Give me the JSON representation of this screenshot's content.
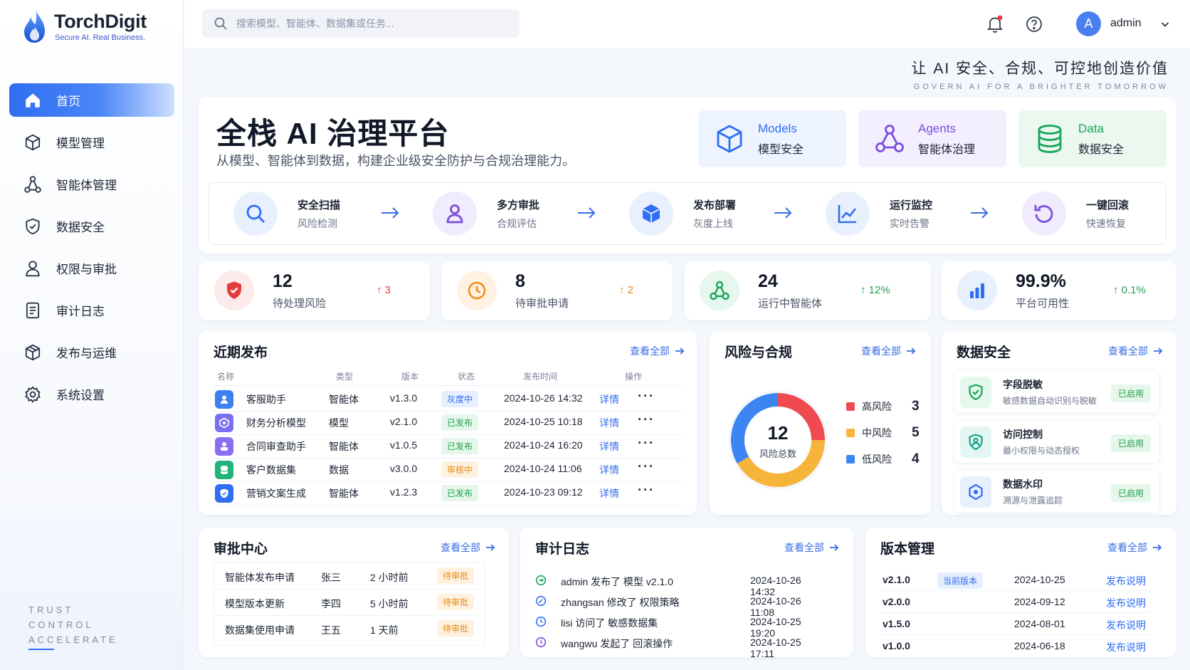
{
  "brand": {
    "name": "TorchDigit",
    "tagline": "Secure AI. Real Business."
  },
  "search": {
    "placeholder": "搜索模型、智能体、数据集或任务..."
  },
  "user": {
    "avatar_letter": "A",
    "name": "admin"
  },
  "sidebar": {
    "items": [
      {
        "label": "首页",
        "icon": "home-icon",
        "active": true
      },
      {
        "label": "模型管理",
        "icon": "cube-icon"
      },
      {
        "label": "智能体管理",
        "icon": "agent-network-icon"
      },
      {
        "label": "数据安全",
        "icon": "shield-icon"
      },
      {
        "label": "权限与审批",
        "icon": "user-icon"
      },
      {
        "label": "审计日志",
        "icon": "document-icon"
      },
      {
        "label": "发布与运维",
        "icon": "package-icon"
      },
      {
        "label": "系统设置",
        "icon": "gear-icon"
      }
    ],
    "footer_lines": [
      "TRUST",
      "CONTROL",
      "ACCELERATE"
    ]
  },
  "slogan": {
    "cn": "让 AI 安全、合规、可控地创造价值",
    "en": "GOVERN AI FOR A BRIGHTER TOMORROW"
  },
  "hero": {
    "title": "全栈 AI 治理平台",
    "subtitle": "从模型、智能体到数据，构建企业级安全防护与合规治理能力。",
    "tiles": [
      {
        "en": "Models",
        "cn": "模型安全",
        "color": "#2f6ef2"
      },
      {
        "en": "Agents",
        "cn": "智能体治理",
        "color": "#7c4ddc"
      },
      {
        "en": "Data",
        "cn": "数据安全",
        "color": "#17a65a"
      }
    ],
    "steps": [
      {
        "title": "安全扫描",
        "sub": "风险检测",
        "icon": "search-icon"
      },
      {
        "title": "多方审批",
        "sub": "合规评估",
        "icon": "user-icon"
      },
      {
        "title": "发布部署",
        "sub": "灰度上线",
        "icon": "box-icon"
      },
      {
        "title": "运行监控",
        "sub": "实时告警",
        "icon": "chart-line-icon"
      },
      {
        "title": "一键回滚",
        "sub": "快速恢复",
        "icon": "rollback-icon"
      }
    ]
  },
  "stats": [
    {
      "value": "12",
      "label": "待处理风险",
      "change": "↑ 3",
      "change_color": "#e23c3c"
    },
    {
      "value": "8",
      "label": "待审批申请",
      "change": "↑ 2",
      "change_color": "#e8891a"
    },
    {
      "value": "24",
      "label": "运行中智能体",
      "change": "↑ 12%",
      "change_color": "#22a04d"
    },
    {
      "value": "99.9%",
      "label": "平台可用性",
      "change": "↑ 0.1%",
      "change_color": "#22a04d"
    }
  ],
  "view_all": "查看全部",
  "releases": {
    "title": "近期发布",
    "columns": [
      "名称",
      "类型",
      "版本",
      "状态",
      "发布时间",
      "操作"
    ],
    "rows": [
      {
        "name": "客服助手",
        "type": "智能体",
        "version": "v1.3.0",
        "status": "灰度中",
        "time": "2024-10-26 14:32",
        "action": "详情"
      },
      {
        "name": "财务分析模型",
        "type": "模型",
        "version": "v2.1.0",
        "status": "已发布",
        "time": "2024-10-25 10:18",
        "action": "详情"
      },
      {
        "name": "合同审查助手",
        "type": "智能体",
        "version": "v1.0.5",
        "status": "已发布",
        "time": "2024-10-24 16:20",
        "action": "详情"
      },
      {
        "name": "客户数据集",
        "type": "数据",
        "version": "v3.0.0",
        "status": "审核中",
        "time": "2024-10-24 11:06",
        "action": "详情"
      },
      {
        "name": "营销文案生成",
        "type": "智能体",
        "version": "v1.2.3",
        "status": "已发布",
        "time": "2024-10-23 09:12",
        "action": "详情"
      }
    ]
  },
  "risk": {
    "title": "风险与合规",
    "total": "12",
    "total_label": "风险总数",
    "chart_data": {
      "type": "pie",
      "categories": [
        "高风险",
        "中风险",
        "低风险"
      ],
      "values": [
        3,
        5,
        4
      ],
      "colors": [
        "#ef4a4f",
        "#f7b43a",
        "#3d86f2"
      ]
    }
  },
  "data_security": {
    "title": "数据安全",
    "items": [
      {
        "title": "字段脱敏",
        "sub": "敏感数据自动识别与脱敏",
        "badge": "已启用"
      },
      {
        "title": "访问控制",
        "sub": "最小权限与动态授权",
        "badge": "已启用"
      },
      {
        "title": "数据水印",
        "sub": "溯源与泄露追踪",
        "badge": "已启用"
      }
    ]
  },
  "approvals": {
    "title": "审批中心",
    "rows": [
      {
        "name": "智能体发布申请",
        "user": "张三",
        "time": "2 小时前",
        "status": "待审批"
      },
      {
        "name": "模型版本更新",
        "user": "李四",
        "time": "5 小时前",
        "status": "待审批"
      },
      {
        "name": "数据集使用申请",
        "user": "王五",
        "time": "1 天前",
        "status": "待审批"
      }
    ]
  },
  "audit": {
    "title": "审计日志",
    "rows": [
      {
        "text": "admin 发布了 模型 v2.1.0",
        "time": "2024-10-26 14:32",
        "color": "#17a65a"
      },
      {
        "text": "zhangsan 修改了 权限策略",
        "time": "2024-10-26 11:08",
        "color": "#2f6ef2"
      },
      {
        "text": "lisi 访问了 敏感数据集",
        "time": "2024-10-25 19:20",
        "color": "#2f6ef2"
      },
      {
        "text": "wangwu 发起了 回滚操作",
        "time": "2024-10-25 17:11",
        "color": "#7c4ddc"
      }
    ]
  },
  "versions": {
    "title": "版本管理",
    "current_label": "当前版本",
    "rows": [
      {
        "version": "v2.1.0",
        "date": "2024-10-25",
        "link": "发布说明",
        "current": true
      },
      {
        "version": "v2.0.0",
        "date": "2024-09-12",
        "link": "发布说明"
      },
      {
        "version": "v1.5.0",
        "date": "2024-08-01",
        "link": "发布说明"
      },
      {
        "version": "v1.0.0",
        "date": "2024-06-18",
        "link": "发布说明"
      }
    ]
  }
}
